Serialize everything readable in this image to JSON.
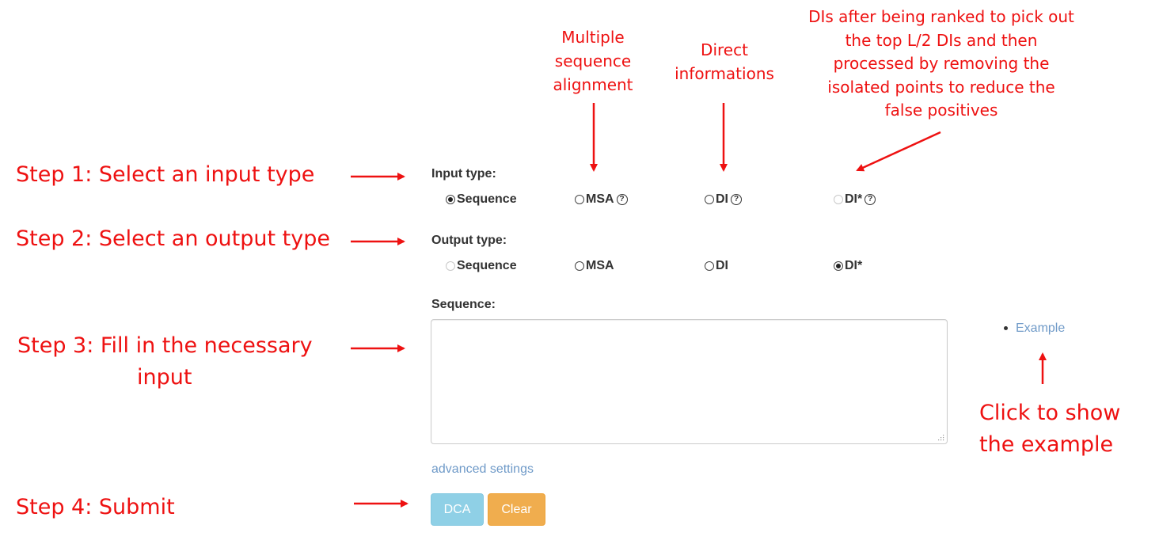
{
  "annotations": {
    "step1": "Step 1: Select an input type",
    "step2": "Step 2: Select an output type",
    "step3_line1": "Step 3: Fill in the necessary",
    "step3_line2": "input",
    "step4": "Step 4: Submit",
    "msa_note": [
      "Multiple",
      "sequence",
      "alignment"
    ],
    "di_note": [
      "Direct",
      "informations"
    ],
    "distar_note": [
      "DIs after being ranked to pick out",
      "the top L/2 DIs and then",
      "processed by removing  the",
      "isolated points to reduce the",
      "false positives"
    ],
    "example_note_line1": "Click to show",
    "example_note_line2": "the example",
    "color": "#ee1111"
  },
  "form": {
    "input_type": {
      "label": "Input type:",
      "options": [
        {
          "label": "Sequence",
          "checked": true,
          "disabled": false,
          "help": false
        },
        {
          "label": "MSA",
          "checked": false,
          "disabled": false,
          "help": true
        },
        {
          "label": "DI",
          "checked": false,
          "disabled": false,
          "help": true
        },
        {
          "label": "DI*",
          "checked": false,
          "disabled": true,
          "help": true
        }
      ]
    },
    "output_type": {
      "label": "Output type:",
      "options": [
        {
          "label": "Sequence",
          "checked": false,
          "disabled": true
        },
        {
          "label": "MSA",
          "checked": false,
          "disabled": false
        },
        {
          "label": "DI",
          "checked": false,
          "disabled": false
        },
        {
          "label": "DI*",
          "checked": true,
          "disabled": false
        }
      ]
    },
    "sequence": {
      "label": "Sequence:",
      "value": ""
    },
    "example_link": "Example",
    "advanced_link": "advanced settings",
    "help_glyph": "?",
    "buttons": {
      "dca": {
        "label": "DCA",
        "color": "#8fd0e6"
      },
      "clear": {
        "label": "Clear",
        "color": "#f0ad4e"
      }
    }
  },
  "icons": {
    "radio": "radio-button-icon",
    "help": "question-circle-icon",
    "bullet": "bullet-icon",
    "arrow": "red-arrow-icon"
  }
}
